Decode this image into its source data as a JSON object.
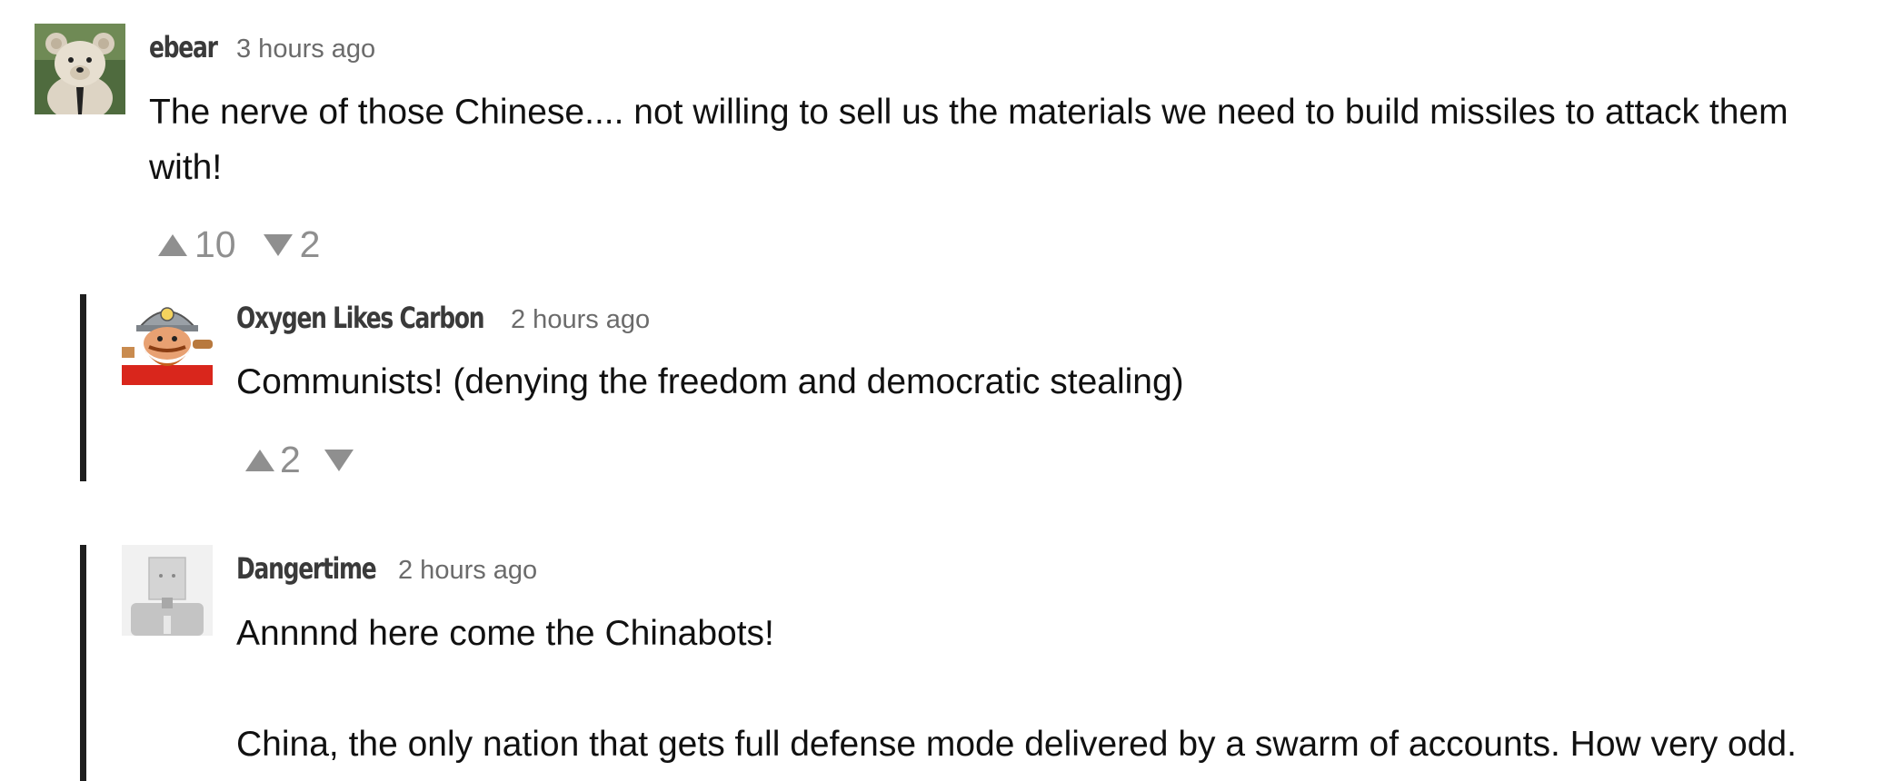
{
  "comments": [
    {
      "author": "ebear",
      "time": "3 hours ago",
      "avatar_icon": "teddy-bear-avatar",
      "body": [
        "The nerve of those Chinese.... not willing to sell us the materials we need to build missiles to attack them with!"
      ],
      "upvotes": "10",
      "downvotes": "2"
    },
    {
      "author": "Oxygen Likes Carbon",
      "time": "2 hours ago",
      "avatar_icon": "miner-avatar",
      "body": [
        "Communists! (denying the freedom and democratic stealing)"
      ],
      "upvotes": "2",
      "downvotes": ""
    },
    {
      "author": "Dangertime",
      "time": "2 hours ago",
      "avatar_icon": "box-character-avatar",
      "body": [
        "Annnnd here come the Chinabots!",
        "China, the only nation that gets full defense mode delivered by a swarm of accounts. How very odd."
      ]
    }
  ],
  "colors": {
    "author": "#3a3a3a",
    "timestamp": "#6b6b6b",
    "vote": "#8f8f8f",
    "reply_bar": "#1e1e1e"
  }
}
